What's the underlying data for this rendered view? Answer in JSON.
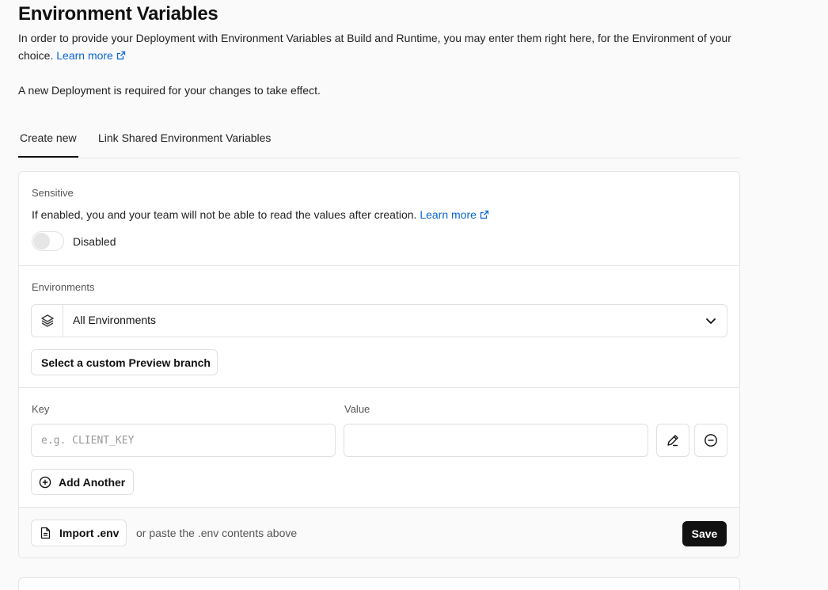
{
  "page": {
    "title": "Environment Variables",
    "intro": "In order to provide your Deployment with Environment Variables at Build and Runtime, you may enter them right here, for the Environment of your choice.",
    "intro_link": "Learn more",
    "note": "A new Deployment is required for your changes to take effect."
  },
  "tabs": [
    {
      "label": "Create new",
      "active": true
    },
    {
      "label": "Link Shared Environment Variables",
      "active": false
    }
  ],
  "sensitive": {
    "heading": "Sensitive",
    "description": "If enabled, you and your team will not be able to read the values after creation.",
    "link": "Learn more",
    "toggle_state": "Disabled",
    "enabled": false
  },
  "environments": {
    "heading": "Environments",
    "selected": "All Environments",
    "preview_branch_button": "Select a custom Preview branch"
  },
  "variables": {
    "key_label": "Key",
    "value_label": "Value",
    "key_placeholder": "e.g. CLIENT_KEY",
    "key_value": "",
    "value_value": "",
    "add_another": "Add Another"
  },
  "footer": {
    "import_button": "Import .env",
    "paste_hint": "or paste the .env contents above",
    "save_button": "Save"
  },
  "colors": {
    "accent_link": "#0a66d8",
    "primary_button": "#111111"
  }
}
